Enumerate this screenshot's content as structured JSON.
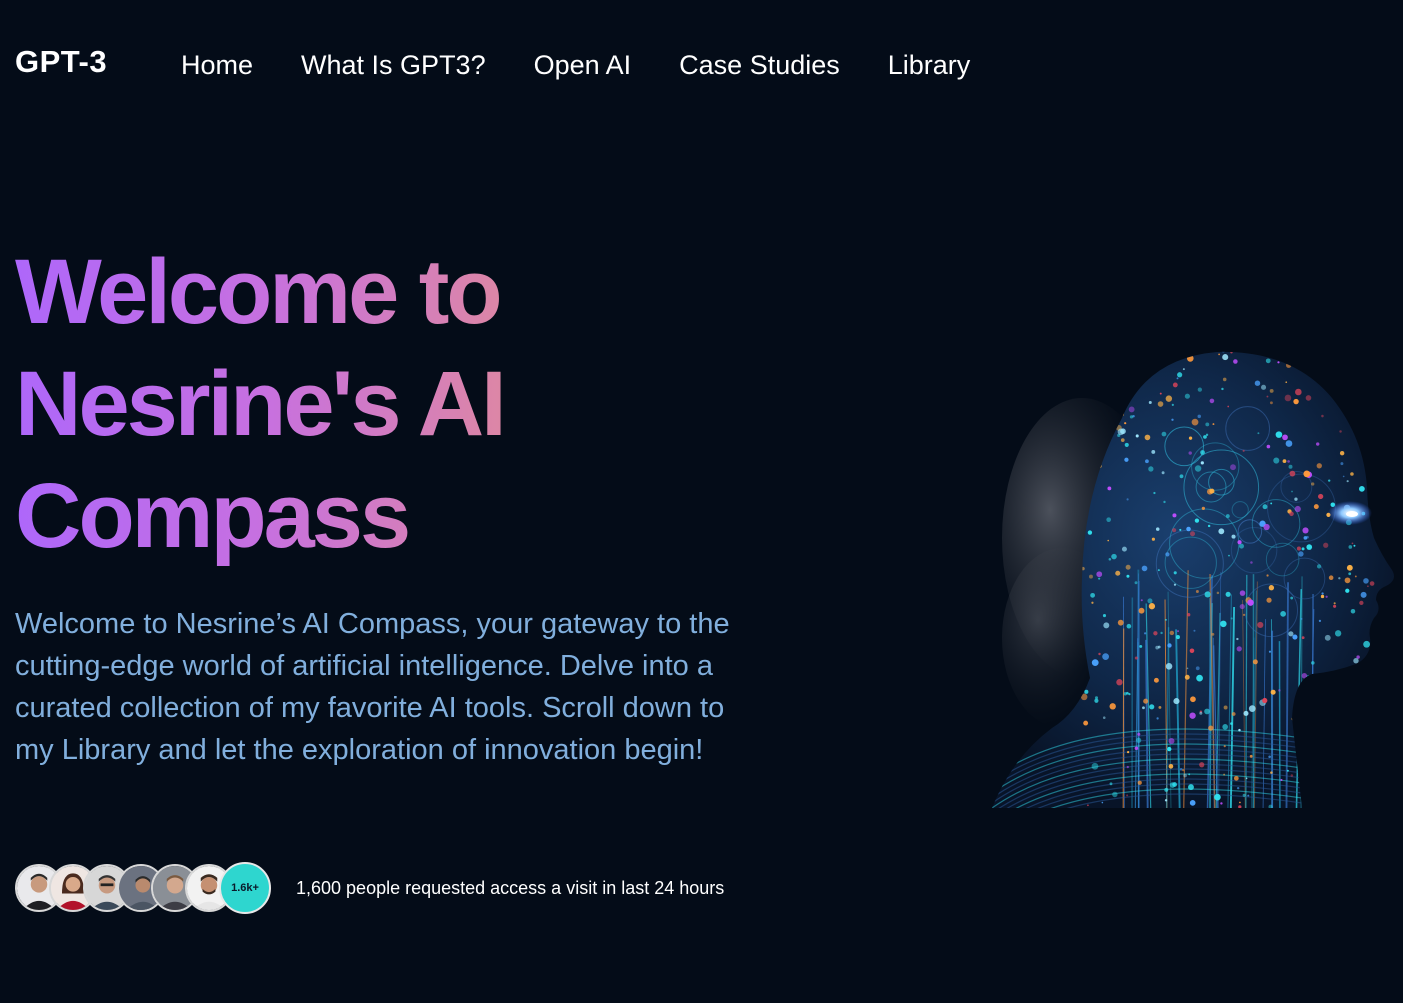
{
  "header": {
    "logo": "GPT-3",
    "nav": [
      {
        "label": "Home"
      },
      {
        "label": "What Is GPT3?"
      },
      {
        "label": "Open AI"
      },
      {
        "label": "Case Studies"
      },
      {
        "label": "Library"
      }
    ]
  },
  "hero": {
    "title_lines": [
      "Welcome to",
      "Nesrine's AI",
      "Compass"
    ],
    "description": "Welcome to Nesrine’s AI Compass, your gateway to the cutting-edge world of artificial intelligence. Delve into a curated collection of my favorite AI tools. Scroll down to my Library and let the exploration of innovation begin!",
    "avatar_count_badge": "1.6k+",
    "people_text": "1,600 people requested access a visit in last 24 hours",
    "image_icon": "ai-head-illustration"
  },
  "colors": {
    "background": "#040c18",
    "gradient_start": "#ae67fa",
    "gradient_end": "#f49867",
    "description": "#81afdd",
    "badge": "#2ed6cf"
  }
}
